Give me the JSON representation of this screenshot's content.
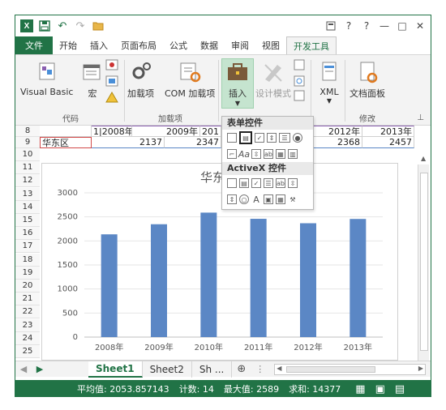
{
  "app": {
    "logo": "X",
    "accent": "#217346"
  },
  "titlebar": {
    "help": "?",
    "help2": "?",
    "minimize": "—",
    "restore": "□",
    "close": "✕"
  },
  "tabs": [
    {
      "label": "文件",
      "kind": "file"
    },
    {
      "label": "开始"
    },
    {
      "label": "插入"
    },
    {
      "label": "页面布局"
    },
    {
      "label": "公式"
    },
    {
      "label": "数据"
    },
    {
      "label": "审阅"
    },
    {
      "label": "视图"
    },
    {
      "label": "开发工具",
      "active": true
    }
  ],
  "ribbon": {
    "visual_basic": "Visual Basic",
    "macro": "宏",
    "addins": "加载项",
    "com_addins": "COM 加载项",
    "insert": "插入",
    "design_mode": "设计模式",
    "xml": "XML",
    "doc_panel": "文档面板",
    "group_code": "代码",
    "group_addins": "加载项",
    "group_modify": "修改"
  },
  "dropdown": {
    "form_controls": "表单控件",
    "activex_controls": "ActiveX 控件"
  },
  "grid": {
    "row8": {
      "num": "8",
      "cells": [
        "",
        "1|2008年",
        "2009年",
        "201",
        "",
        "",
        "2012年",
        "2013年"
      ]
    },
    "row9": {
      "num": "9",
      "a": "华东区",
      "values": [
        "2137",
        "2347",
        "",
        "",
        "2368",
        "2457"
      ]
    },
    "rows": [
      "10",
      "11",
      "12",
      "13",
      "14",
      "15",
      "16",
      "17",
      "18",
      "19",
      "20",
      "21",
      "22",
      "23",
      "24",
      "25"
    ]
  },
  "chart_data": {
    "type": "bar",
    "title": "华东",
    "categories": [
      "2008年",
      "2009年",
      "2010年",
      "2011年",
      "2012年",
      "2013年"
    ],
    "values": [
      2137,
      2347,
      2589,
      2460,
      2368,
      2457
    ],
    "ylim": [
      0,
      3000
    ],
    "yticks": [
      0,
      500,
      1000,
      1500,
      2000,
      2500,
      3000
    ],
    "color": "#5b87c5",
    "grid": true
  },
  "sheets": [
    {
      "label": "Sheet1",
      "active": true
    },
    {
      "label": "Sheet2"
    },
    {
      "label": "Sh ..."
    }
  ],
  "sheetbar": {
    "add": "⊕",
    "more": "⋮"
  },
  "status": {
    "average": "平均值: 2053.857143",
    "count": "计数: 14",
    "max": "最大值: 2589",
    "sum": "求和: 14377"
  }
}
